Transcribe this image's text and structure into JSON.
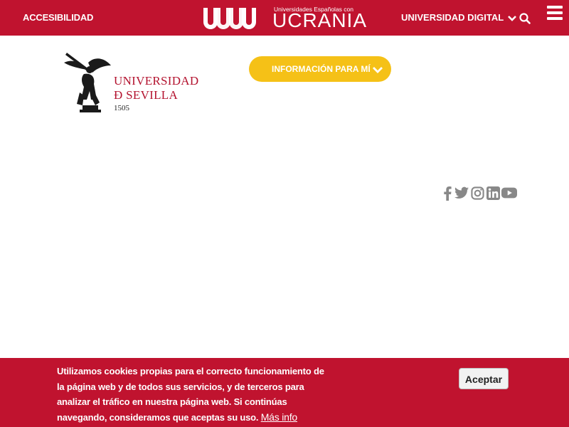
{
  "topbar": {
    "accessibility_label": "ACCESIBILIDAD",
    "ucrania_small": "Universidades Españolas con",
    "ucrania_big": "UCRANIA",
    "digital_label": "UNIVERSIDAD DIGITAL",
    "icons": [
      "chevron-down-icon",
      "search-icon",
      "hamburger-menu-icon"
    ]
  },
  "header": {
    "logo_line1": "UNIVERSIDAD",
    "logo_line2": "Ð SEVILLA",
    "logo_year": "1505",
    "info_button": "INFORMACIÓN PARA MÍ"
  },
  "social": {
    "icons": [
      "facebook-icon",
      "twitter-icon",
      "instagram-icon",
      "linkedin-icon",
      "youtube-icon"
    ],
    "color": "#888888"
  },
  "cookie": {
    "text": "Utilizamos cookies propias para el correcto funcionamiento de la página web y de todos sus servicios, y de terceros para analizar el tráfico en nuestra página web. Si continúas navegando, consideramos que aceptas su uso.",
    "more_link": "Más info",
    "accept_button": "Aceptar"
  },
  "colors": {
    "brand_red": "#c0132f",
    "accent_yellow": "#f5c117"
  }
}
